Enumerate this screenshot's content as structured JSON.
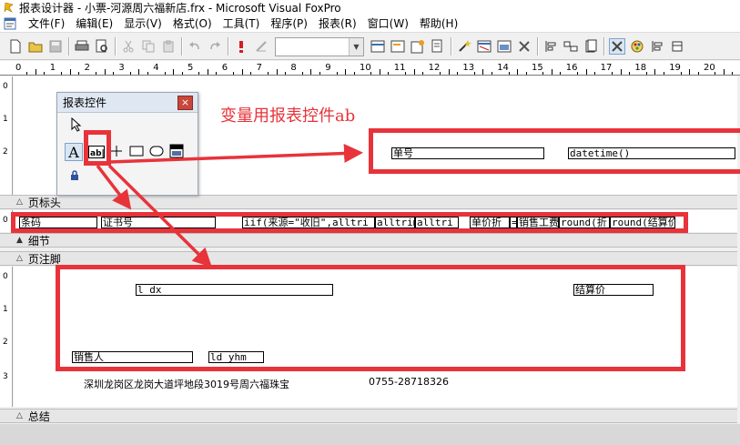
{
  "window": {
    "title": "报表设计器 - 小票-河源周六福新店.frx - Microsoft Visual FoxPro"
  },
  "menu": [
    "文件(F)",
    "编辑(E)",
    "显示(V)",
    "格式(O)",
    "工具(T)",
    "程序(P)",
    "报表(R)",
    "窗口(W)",
    "帮助(H)"
  ],
  "ruler": {
    "numbers": [
      "0",
      "1",
      "2",
      "3",
      "4",
      "5",
      "6",
      "7",
      "8",
      "9",
      "10",
      "11",
      "12",
      "13",
      "14",
      "15",
      "16",
      "17",
      "18",
      "19",
      "20"
    ]
  },
  "bands": {
    "page_header": "页标头",
    "detail": "细节",
    "page_footer": "页注脚",
    "summary": "总结"
  },
  "page_header_fields": {
    "danhao": "单号",
    "datetime": "datetime()"
  },
  "detail_fields": [
    "条码",
    "证书号",
    "iif(来源=\"收旧\",alltri",
    "alltrim(",
    "alltri",
    "单价折",
    "=",
    "销售工费",
    "round(折",
    "round(结算价"
  ],
  "footer_fields": {
    "l_dx": "l_dx",
    "jiesuanjia": "结算价",
    "xiaoshouren": "销售人",
    "ld_yhm": "ld_yhm"
  },
  "footer_text": {
    "address": "深圳龙岗区龙岗大道坪地段3019号周六福珠宝",
    "phone": "0755-28718326"
  },
  "palette": {
    "title": "报表控件",
    "close": "×"
  },
  "annotation": {
    "text": "变量用报表控件ab",
    "color": "#e8333a"
  }
}
